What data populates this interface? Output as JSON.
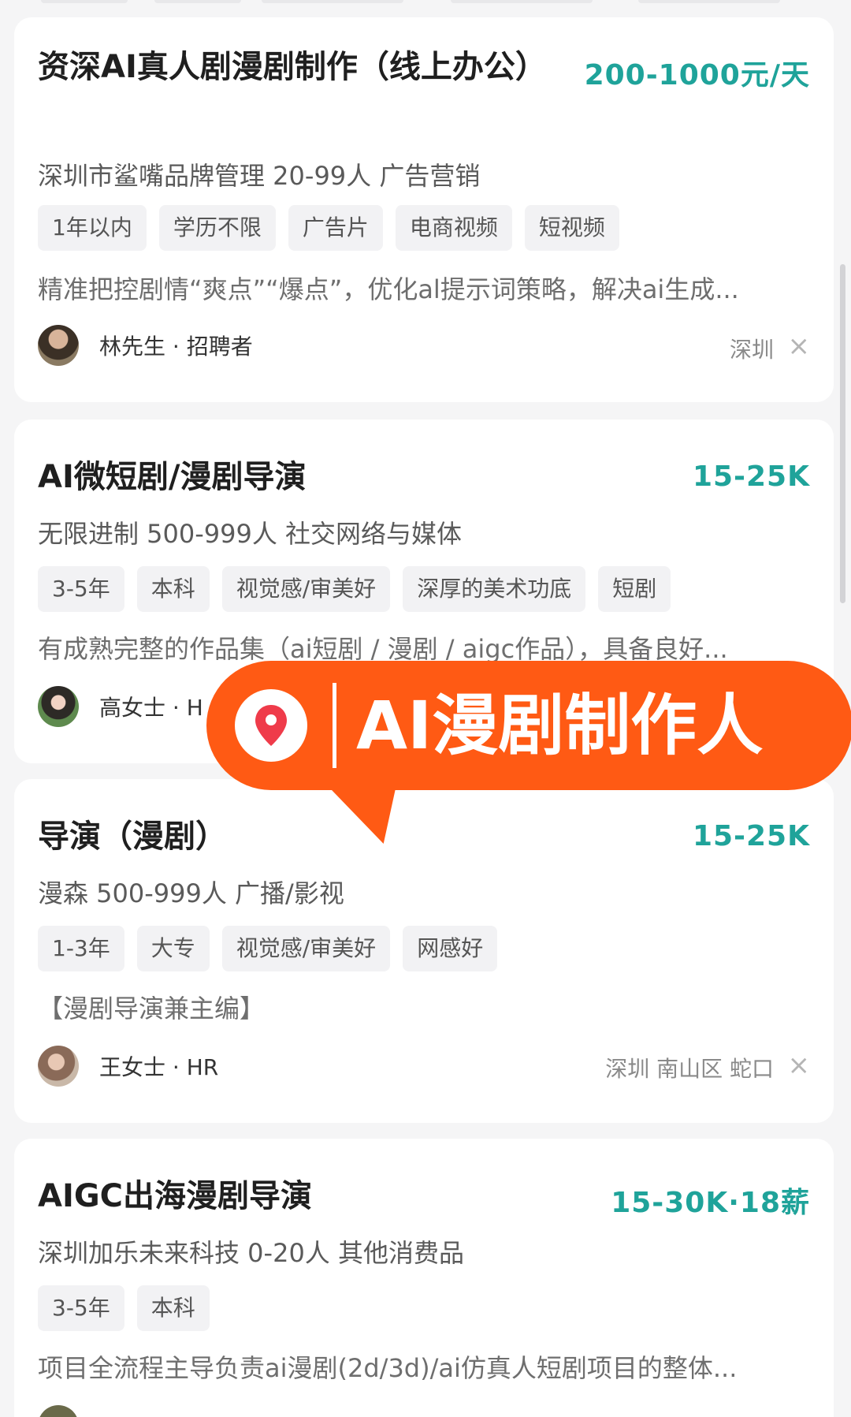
{
  "jobs": [
    {
      "title": "资深AI真人剧漫剧制作（线上办公）",
      "salary": "200-1000元/天",
      "company": "深圳市鲨嘴品牌管理 20-99人 广告营销",
      "tags": [
        "1年以内",
        "学历不限",
        "广告片",
        "电商视频",
        "短视频"
      ],
      "description": "精准把控剧情“爽点”“爆点”，优化al提示词策略，解决ai生成...",
      "recruiter": "林先生 · 招聘者",
      "location": "深圳"
    },
    {
      "title": "AI微短剧/漫剧导演",
      "salary": "15-25K",
      "company": "无限进制 500-999人 社交网络与媒体",
      "tags": [
        "3-5年",
        "本科",
        "视觉感/审美好",
        "深厚的美术功底",
        "短剧"
      ],
      "description": "有成熟完整的作品集（ai短剧 / 漫剧 / aigc作品），具备良好...",
      "recruiter": "高女士 · H",
      "location": ""
    },
    {
      "title": "导演（漫剧）",
      "salary": "15-25K",
      "company": "漫森 500-999人 广播/影视",
      "tags": [
        "1-3年",
        "大专",
        "视觉感/审美好",
        "网感好"
      ],
      "description": "【漫剧导演兼主编】",
      "recruiter": "王女士 · HR",
      "location": "深圳 南山区 蛇口"
    },
    {
      "title": "AIGC出海漫剧导演",
      "salary": "15-30K·18薪",
      "company": "深圳加乐未来科技 0-20人 其他消费品",
      "tags": [
        "3-5年",
        "本科"
      ],
      "description": "项目全流程主导负责ai漫剧(2d/3d)/ai仿真人短剧项目的整体..."
    }
  ],
  "overlay": {
    "text": "AI漫剧制作人",
    "icon": "location-pin-icon",
    "color": "#ff5a14"
  },
  "colors": {
    "salary": "#1fa39a",
    "background": "#f5f5f6"
  },
  "close_glyph": "×"
}
